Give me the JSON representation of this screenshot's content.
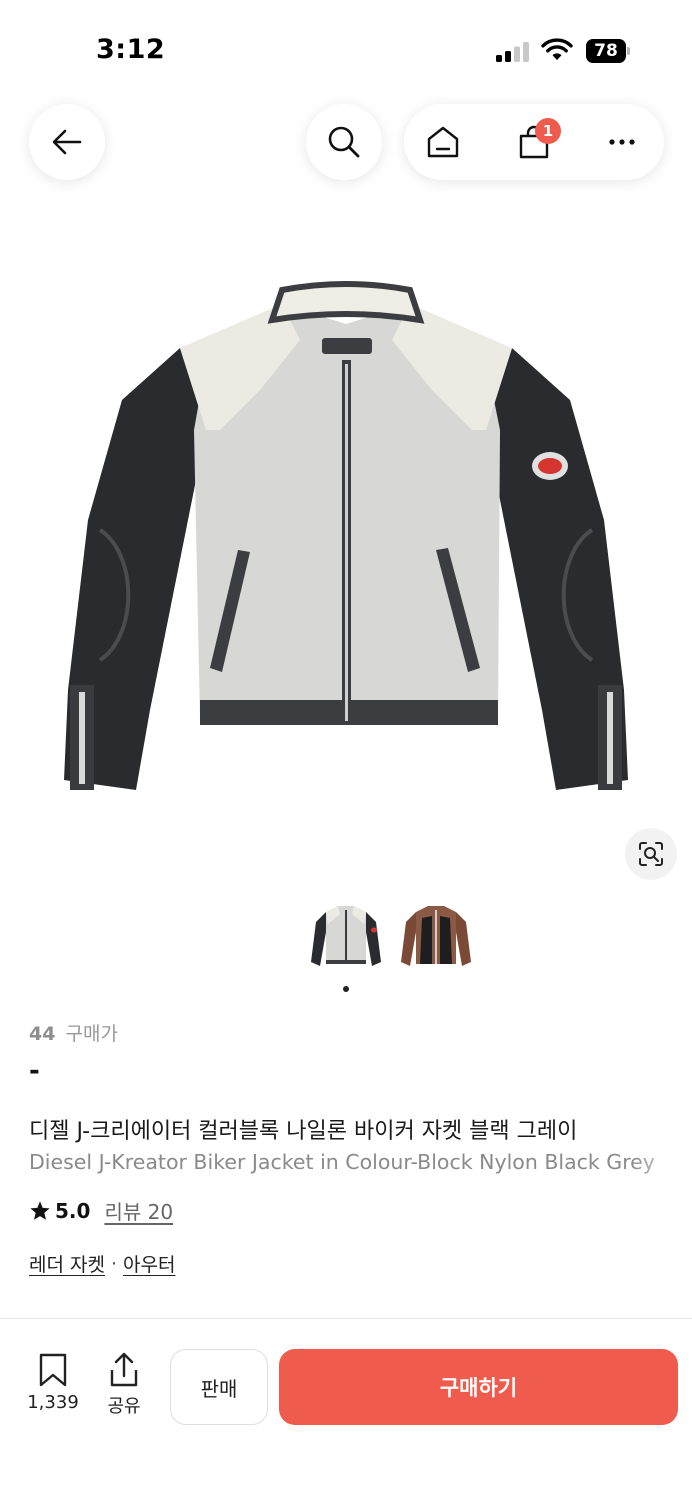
{
  "status_bar": {
    "time": "3:12",
    "battery": "78"
  },
  "nav": {
    "cart_badge": "1"
  },
  "product": {
    "size_value": "44",
    "size_label": "구매가",
    "price": "-",
    "title_kr": "디젤 J-크리에이터 컬러블록 나일론 바이커 자켓 블랙 그레이",
    "title_en": "Diesel J-Kreator Biker Jacket in Colour-Block Nylon Black Grey",
    "rating": "5.0",
    "review_label": "리뷰 20",
    "categories": [
      "레더 자켓",
      "아우터"
    ],
    "category_separator": "·"
  },
  "gallery": {
    "thumbnails": [
      "white-grey-black-jacket",
      "brown-black-jacket"
    ],
    "active_index": 0
  },
  "bottom_bar": {
    "bookmark_count": "1,339",
    "share_label": "공유",
    "sell_label": "판매",
    "buy_label": "구매하기"
  },
  "colors": {
    "accent": "#ef5b4c",
    "text_primary": "#1a1a1a",
    "text_muted": "#8a8a8a"
  },
  "icons": [
    "back-arrow-icon",
    "search-icon",
    "home-icon",
    "shopping-bag-icon",
    "more-icon",
    "lens-icon",
    "star-icon",
    "bookmark-icon",
    "share-icon"
  ]
}
